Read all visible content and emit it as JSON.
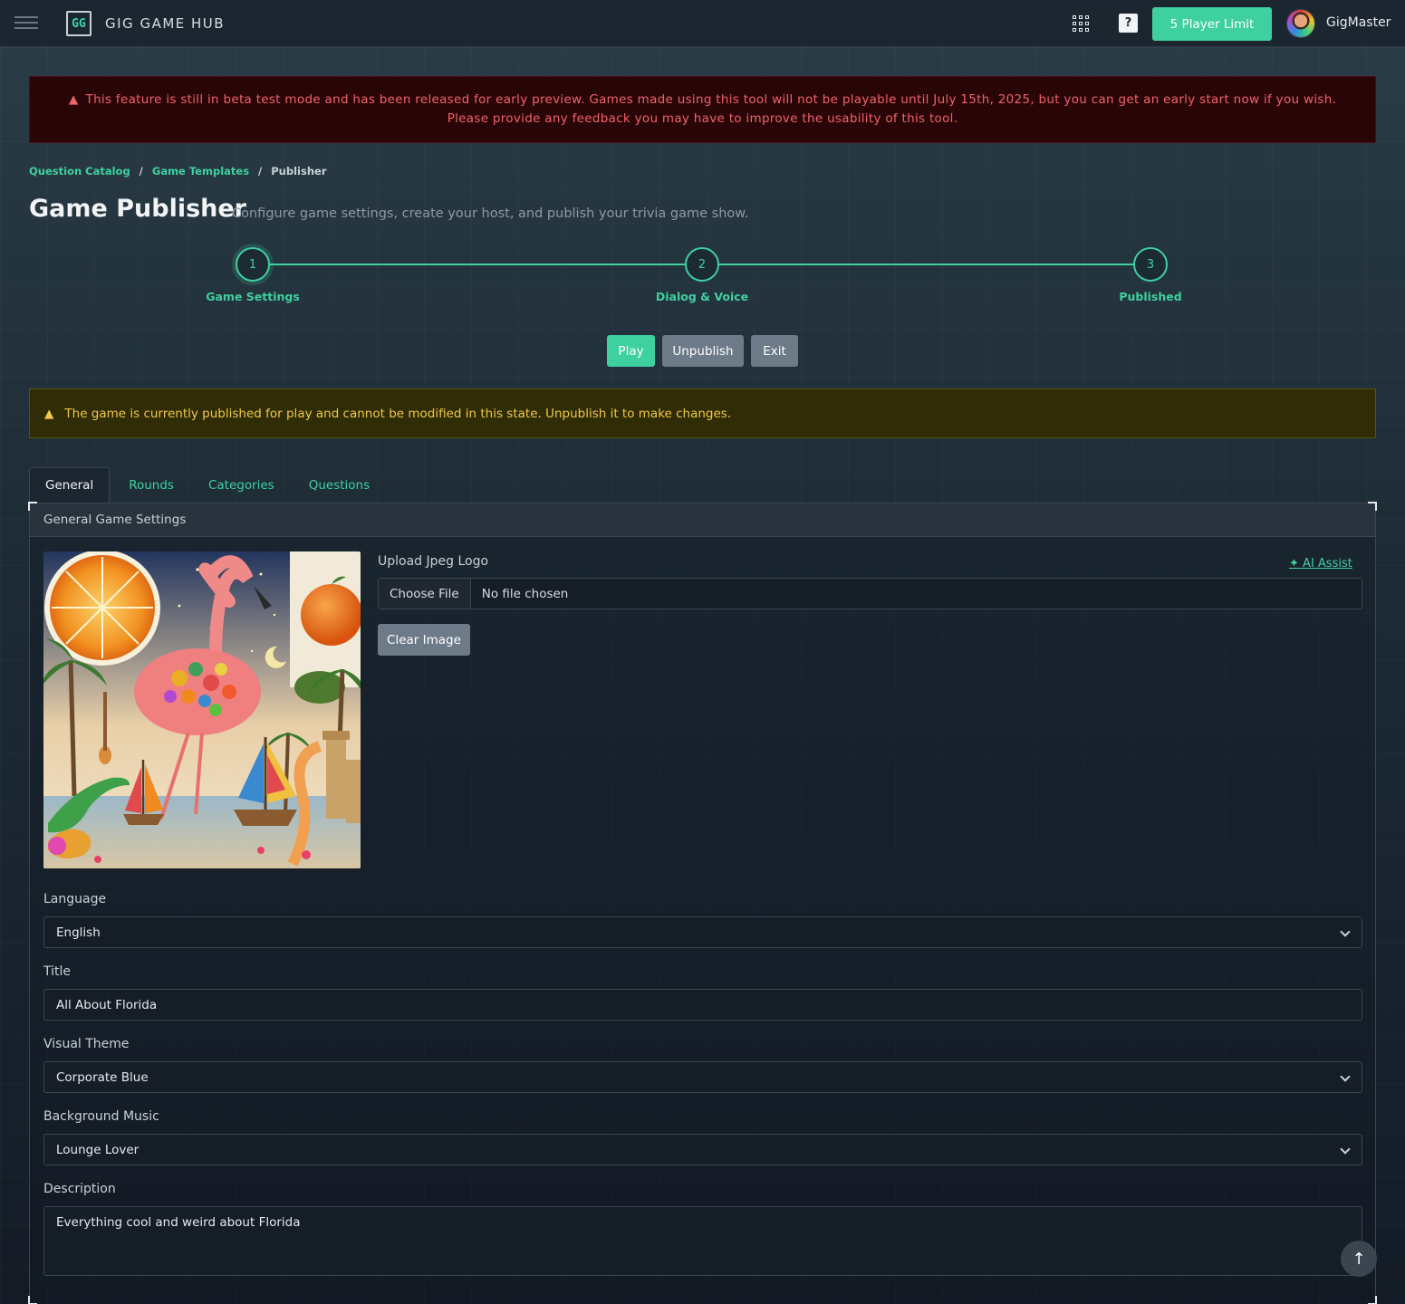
{
  "header": {
    "logo_text": "GG",
    "brand": "GIG GAME HUB",
    "player_limit": "5 Player Limit",
    "help": "?",
    "username": "GigMaster"
  },
  "alerts": {
    "beta_line1": "This feature is still in beta test mode and has been released for early preview. Games made using this tool will not be playable until July 15th, 2025, but you can get an early start now if you wish.",
    "beta_line2": "Please provide any feedback you may have to improve the usability of this tool.",
    "published": "The game is currently published for play and cannot be modified in this state. Unpublish it to make changes."
  },
  "breadcrumb": {
    "items": [
      "Question Catalog",
      "Game Templates",
      "Publisher"
    ]
  },
  "page": {
    "title": "Game Publisher",
    "subtitle": "Configure game settings, create your host, and publish your trivia game show."
  },
  "stepper": {
    "steps": [
      {
        "number": "1",
        "label": "Game Settings"
      },
      {
        "number": "2",
        "label": "Dialog & Voice"
      },
      {
        "number": "3",
        "label": "Published"
      }
    ]
  },
  "actions": {
    "play": "Play",
    "unpublish": "Unpublish",
    "exit": "Exit"
  },
  "tabs": [
    "General",
    "Rounds",
    "Categories",
    "Questions"
  ],
  "panel": {
    "header": "General Game Settings",
    "upload_label": "Upload Jpeg Logo",
    "ai_assist": "AI Assist",
    "choose_file": "Choose File",
    "file_status": "No file chosen",
    "clear_image": "Clear Image",
    "language_label": "Language",
    "language_value": "English",
    "title_label": "Title",
    "title_value": "All About Florida",
    "theme_label": "Visual Theme",
    "theme_value": "Corporate Blue",
    "music_label": "Background Music",
    "music_value": "Lounge Lover",
    "description_label": "Description",
    "description_value": "Everything cool and weird about Florida"
  },
  "colors": {
    "accent": "#3fd0a0",
    "danger_bg": "#2a0508",
    "danger_text": "#f0636a",
    "warning_bg": "#302c06",
    "warning_text": "#f0c94a",
    "secondary_btn": "#6d7b88"
  }
}
